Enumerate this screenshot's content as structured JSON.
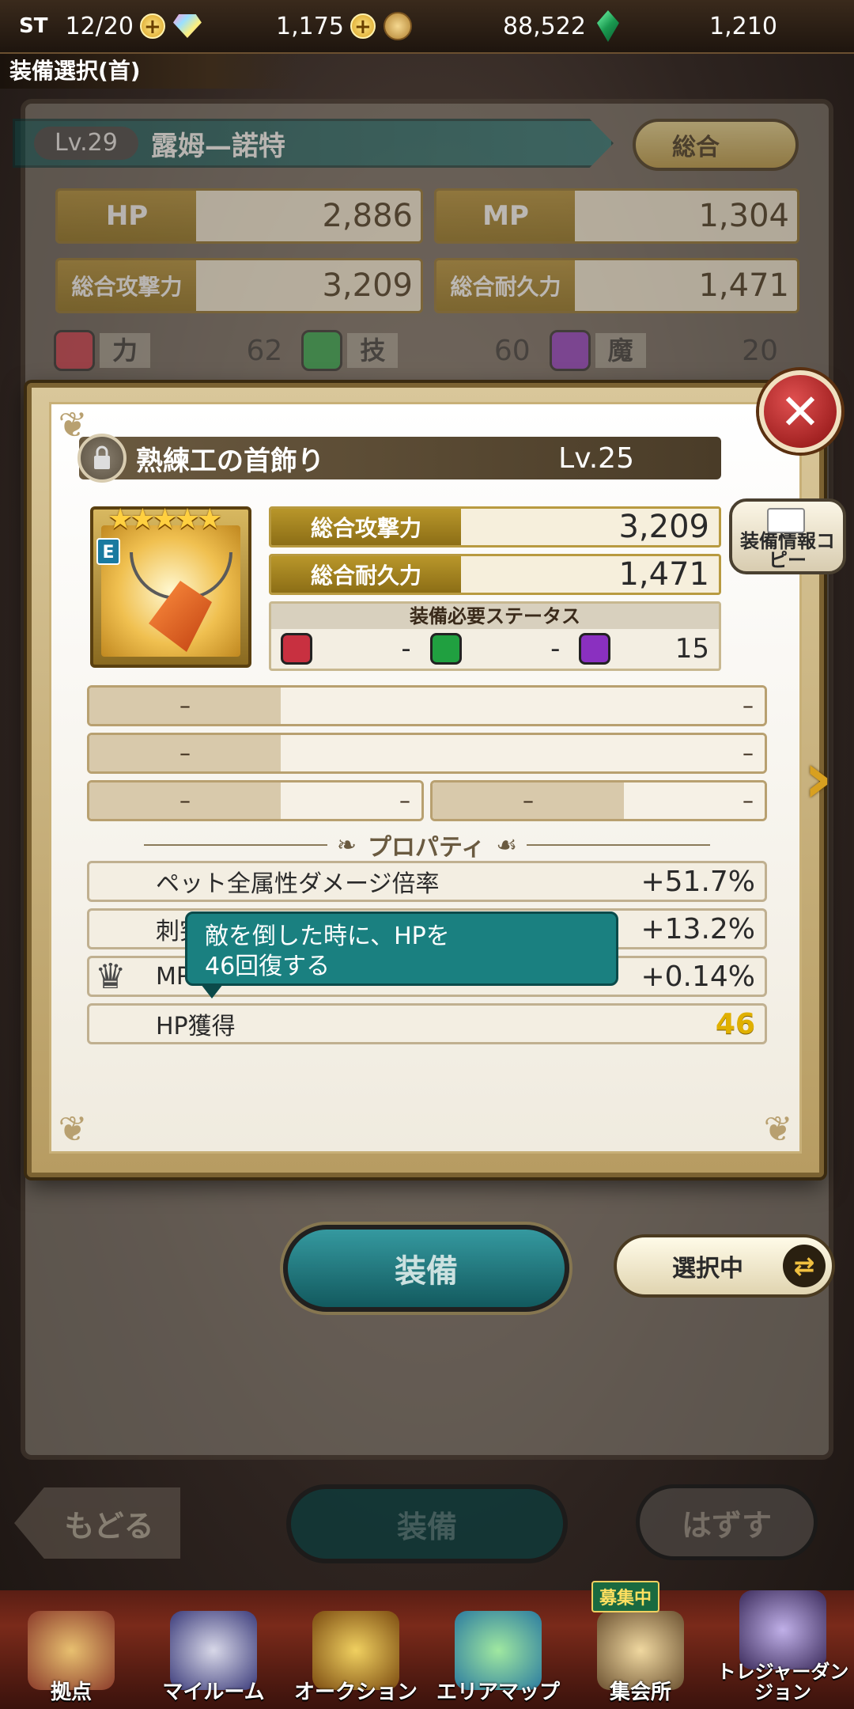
{
  "topbar": {
    "st_label": "ST",
    "st_value": "12/20",
    "gems": "1,175",
    "coins": "88,522",
    "emeralds": "1,210"
  },
  "page_title": "装備選択(首)",
  "character": {
    "level": "Lv.29",
    "name": "露姆—諾特",
    "sort_label": "総合",
    "stats": [
      {
        "key": "HP",
        "value": "2,886"
      },
      {
        "key": "MP",
        "value": "1,304"
      },
      {
        "key": "総合攻撃力",
        "value": "3,209"
      },
      {
        "key": "総合耐久力",
        "value": "1,471"
      }
    ],
    "attributes": [
      {
        "name": "力",
        "value": "62",
        "color": "#c83040"
      },
      {
        "name": "技",
        "value": "60",
        "color": "#20a040"
      },
      {
        "name": "魔",
        "value": "20",
        "color": "#8a30c0"
      }
    ]
  },
  "item": {
    "name": "熟練工の首飾り",
    "level": "Lv.25",
    "stars": "★★★★★",
    "badge": "E",
    "attack_label": "総合攻撃力",
    "attack_value": "3,209",
    "defense_label": "総合耐久力",
    "defense_value": "1,471",
    "req_title": "装備必要ステータス",
    "req": [
      {
        "value": "-",
        "color": "#c83040"
      },
      {
        "value": "-",
        "color": "#20a040"
      },
      {
        "value": "15",
        "color": "#8a30c0"
      }
    ],
    "slots": {
      "row1_left": "–",
      "row1_right": "–",
      "row2_left": "–",
      "row2_right": "–",
      "row3a_left": "–",
      "row3a_right": "–",
      "row3b_left": "–",
      "row3b_right": "–"
    },
    "property_title": "プロパティ",
    "properties": [
      {
        "name": "ペット全属性ダメージ倍率",
        "value": "+51.7%"
      },
      {
        "name": "刺突",
        "value": "+13.2%"
      },
      {
        "name": "MP",
        "value": "+0.14%"
      },
      {
        "name": "HP獲得",
        "value": "46"
      }
    ],
    "tooltip_line1": "敵を倒した時に、HPを",
    "tooltip_line2": "46回復する",
    "copy_label": "装備情報コピー"
  },
  "actions": {
    "equip": "装備",
    "selecting": "選択中",
    "back": "もどる",
    "equip_bottom": "装備",
    "remove": "はずす"
  },
  "nav": [
    {
      "label": "拠点",
      "icon": "base-icon"
    },
    {
      "label": "マイルーム",
      "icon": "my-room-icon"
    },
    {
      "label": "オークション",
      "icon": "auction-icon"
    },
    {
      "label": "エリアマップ",
      "icon": "area-map-icon"
    },
    {
      "label": "集会所",
      "icon": "gathering-hall-icon",
      "badge": "募集中"
    },
    {
      "label": "トレジャーダンジョン",
      "icon": "treasure-dungeon-icon"
    }
  ]
}
